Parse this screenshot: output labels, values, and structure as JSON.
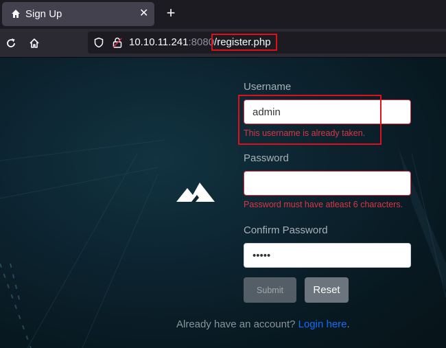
{
  "browser": {
    "tab_title": "Sign Up",
    "tab_close": "✕",
    "new_tab": "+",
    "url_host": "10.10.11.241",
    "url_port": ":8080",
    "url_path": "/register.php"
  },
  "form": {
    "username_label": "Username",
    "username_value": "admin",
    "username_error": "This username is already taken.",
    "password_label": "Password",
    "password_value": "",
    "password_error": "Password must have atleast 6 characters.",
    "confirm_label": "Confirm Password",
    "confirm_value": "abcde",
    "submit_label": "Submit",
    "reset_label": "Reset"
  },
  "footer": {
    "prompt": "Already have an account?",
    "login_link": "Login here",
    "period": "."
  },
  "colors": {
    "error": "#dc3545",
    "link": "#0d6efd",
    "highlight_box": "#e0101a"
  },
  "icons": {
    "tab": "home-icon",
    "reload": "reload-icon",
    "home": "home-icon",
    "shield": "shield-icon",
    "lock": "lock-icon",
    "logo": "mountain-logo"
  }
}
